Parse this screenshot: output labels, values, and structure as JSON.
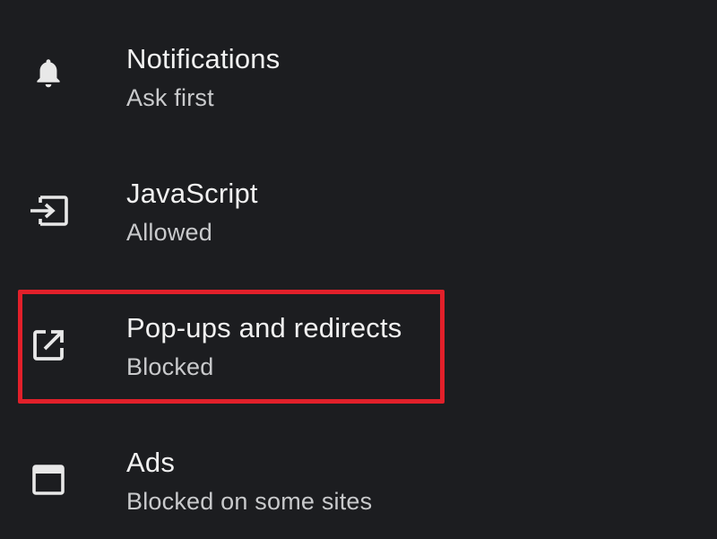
{
  "settings": {
    "items": [
      {
        "title": "Notifications",
        "subtitle": "Ask first",
        "icon": "bell-icon"
      },
      {
        "title": "JavaScript",
        "subtitle": "Allowed",
        "icon": "javascript-icon"
      },
      {
        "title": "Pop-ups and redirects",
        "subtitle": "Blocked",
        "icon": "open-in-new-icon",
        "highlighted": true
      },
      {
        "title": "Ads",
        "subtitle": "Blocked on some sites",
        "icon": "ads-window-icon"
      }
    ]
  },
  "colors": {
    "background": "#1c1d20",
    "title_text": "#f1f1f1",
    "subtitle_text": "#c9cacc",
    "icon": "#e8e8e8",
    "highlight": "#e1202a"
  }
}
